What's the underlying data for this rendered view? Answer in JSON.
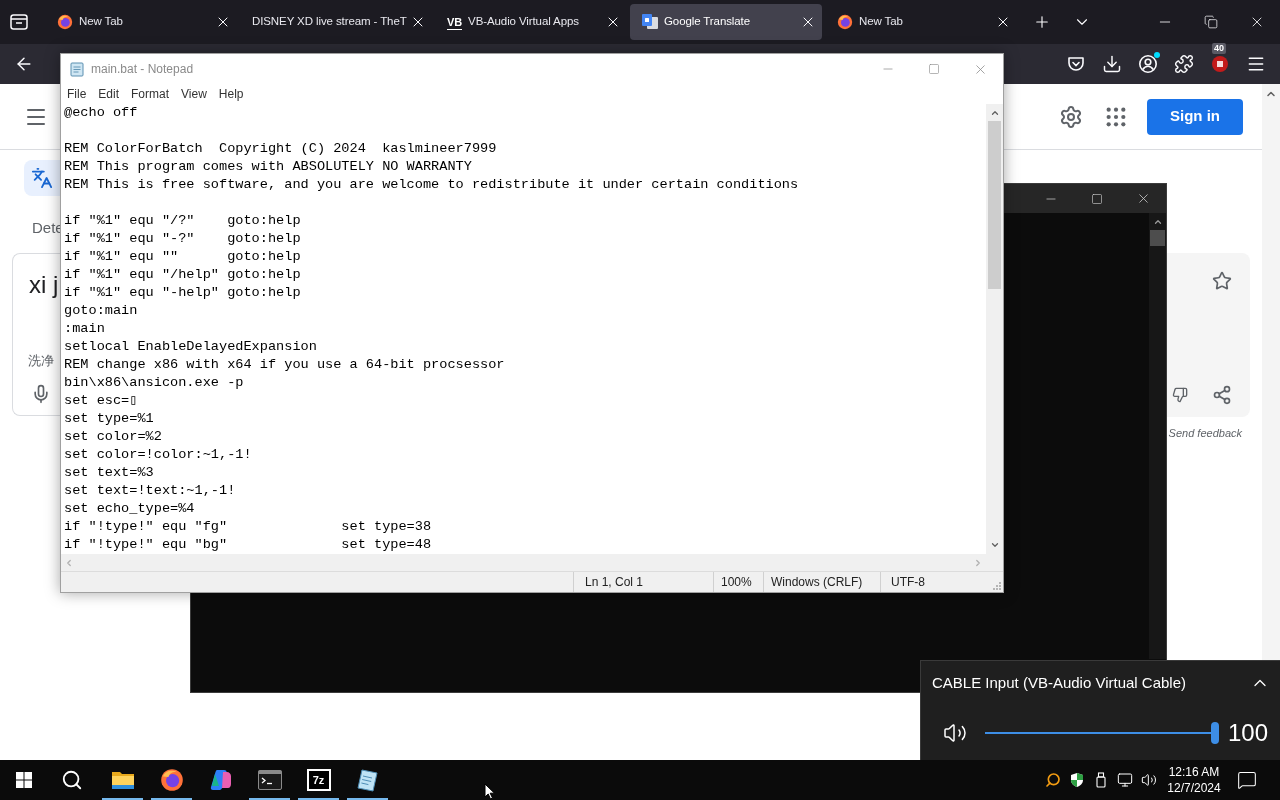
{
  "browser": {
    "tabs": [
      {
        "kind": "firefox",
        "title": "New Tab",
        "selected": false
      },
      {
        "kind": "plain",
        "title": "DISNEY XD live stream - TheT",
        "selected": false
      },
      {
        "kind": "vb",
        "favicon_text": "VB",
        "title": "VB-Audio Virtual Apps",
        "selected": false
      },
      {
        "kind": "translate",
        "title": "Google Translate",
        "selected": true
      },
      {
        "kind": "firefox",
        "title": "New Tab",
        "selected": false
      }
    ],
    "extension_badge": "40"
  },
  "translate_page": {
    "sign_in": "Sign in",
    "source_label": "Dete",
    "source_text": "xi j",
    "suggestion": "洗净",
    "feedback": "Send feedback"
  },
  "notepad": {
    "title": "main.bat - Notepad",
    "menu": [
      "File",
      "Edit",
      "Format",
      "View",
      "Help"
    ],
    "blocks": [
      [
        "@echo off"
      ],
      [
        "REM ColorForBatch  Copyright (C) 2024  kaslmineer7999",
        "REM This program comes with ABSOLUTELY NO WARRANTY",
        "REM This is free software, and you are welcome to redistribute it under certain conditions"
      ],
      [
        "if \"%1\" equ \"/?\"    goto:help",
        "if \"%1\" equ \"-?\"    goto:help",
        "if \"%1\" equ \"\"      goto:help",
        "if \"%1\" equ \"/help\" goto:help",
        "if \"%1\" equ \"-help\" goto:help",
        "goto:main",
        ":main",
        "setlocal EnableDelayedExpansion",
        "REM change x86 with x64 if you use a 64-bit procsessor",
        "bin\\x86\\ansicon.exe -p",
        "set esc=▯",
        "set type=%1",
        "set color=%2",
        "set color=!color:~1,-1!",
        "set text=%3",
        "set text=!text:~1,-1!",
        "set echo_type=%4",
        "if \"!type!\" equ \"fg\"              set type=38",
        "if \"!type!\" equ \"bg\"              set type=48"
      ]
    ],
    "status": {
      "position": "Ln 1, Col 1",
      "zoom": "100%",
      "line_ending": "Windows (CRLF)",
      "encoding": "UTF-8"
    }
  },
  "volume": {
    "device": "CABLE Input (VB-Audio Virtual Cable)",
    "level": 1,
    "reading": "100"
  },
  "taskbar": {
    "apps": [
      {
        "kind": "explorer",
        "running": true
      },
      {
        "kind": "firefox",
        "running": true
      },
      {
        "kind": "copilot",
        "running": false
      },
      {
        "kind": "terminal",
        "running": true
      },
      {
        "kind": "sevenzip",
        "label": "7z",
        "running": true
      },
      {
        "kind": "notepad",
        "running": true
      }
    ],
    "clock": {
      "time": "12:16 AM",
      "date": "12/7/2024"
    }
  }
}
